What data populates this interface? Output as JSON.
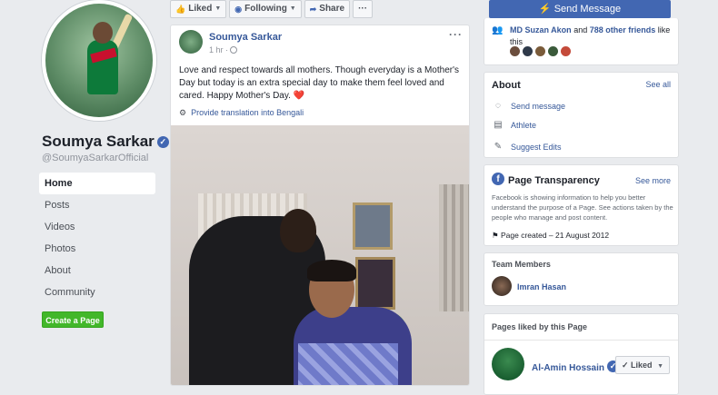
{
  "page": {
    "name": "Soumya Sarkar",
    "handle": "@SoumyaSarkarOfficial",
    "nav": [
      {
        "label": "Home",
        "active": true
      },
      {
        "label": "Posts"
      },
      {
        "label": "Videos"
      },
      {
        "label": "Photos"
      },
      {
        "label": "About"
      },
      {
        "label": "Community"
      }
    ],
    "create_page_label": "Create a Page"
  },
  "actionbar": {
    "liked_label": "Liked",
    "following_label": "Following",
    "share_label": "Share",
    "more_label": "···"
  },
  "send_message_label": "Send Message",
  "post": {
    "author": "Soumya Sarkar",
    "time": "1 hr ·",
    "more": "···",
    "text": "Love and respect towards all mothers. Though everyday is a Mother's Day but today is an extra special day to make them feel loved and cared. Happy Mother's Day.",
    "heart": "❤️",
    "translate": "Provide translation into Bengali"
  },
  "likes": {
    "friend": "MD Suzan Akon",
    "and": "and",
    "count": "788 other friends",
    "suffix": "like this"
  },
  "about": {
    "title": "About",
    "see_all": "See all",
    "rows": [
      {
        "icon": "messenger-icon",
        "label": "Send message"
      },
      {
        "icon": "tag-icon",
        "label": "Athlete"
      },
      {
        "icon": "pencil-icon",
        "label": "Suggest Edits"
      }
    ]
  },
  "transparency": {
    "title": "Page Transparency",
    "see_more": "See more",
    "description": "Facebook is showing information to help you better understand the purpose of a Page. See actions taken by the people who manage and post content.",
    "created": "Page created – 21 August 2012"
  },
  "team": {
    "title": "Team Members",
    "member": "Imran Hasan"
  },
  "liked_pages": {
    "title": "Pages liked by this Page",
    "name": "Al-Amin Hossain",
    "button": "Liked"
  },
  "colors": {
    "brand": "#4267b2",
    "link": "#365899",
    "create_button": "#42b72a"
  }
}
